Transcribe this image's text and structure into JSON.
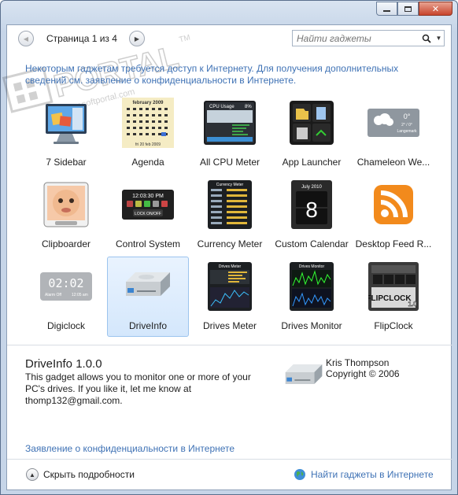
{
  "window": {
    "controls": [
      "minimize",
      "maximize",
      "close"
    ]
  },
  "toolbar": {
    "page_label": "Страница 1 из 4",
    "search_placeholder": "Найти гаджеты"
  },
  "privacy_note": "Некоторым гаджетам требуется доступ к Интернету. Для получения дополнительных сведений см. заявление о конфиденциальности в Интернете.",
  "watermark": {
    "text": "PORTAL",
    "sub": "www.softportal.com",
    "mark": "TM"
  },
  "gadgets": [
    {
      "label": "7 Sidebar"
    },
    {
      "label": "Agenda"
    },
    {
      "label": "All CPU Meter"
    },
    {
      "label": "App Launcher"
    },
    {
      "label": "Chameleon We..."
    },
    {
      "label": "Clipboarder"
    },
    {
      "label": "Control System"
    },
    {
      "label": "Currency Meter"
    },
    {
      "label": "Custom Calendar"
    },
    {
      "label": "Desktop Feed R..."
    },
    {
      "label": "Digiclock"
    },
    {
      "label": "DriveInfo",
      "selected": true
    },
    {
      "label": "Drives Meter"
    },
    {
      "label": "Drives Monitor"
    },
    {
      "label": "FlipClock"
    }
  ],
  "thumb_text": {
    "agenda_month": "february 2009",
    "agenda_footer": "fri 20 feb 2009",
    "cpu_title": "CPU Usage",
    "cpu_pct": "8%",
    "chameleon_temp": "0°",
    "chameleon_range": "2° / 0°",
    "chameleon_city": "Langemark",
    "control_time": "12:03:30 PM",
    "control_lock": "LOCK ON/OFF",
    "currency_title": "Currency Meter",
    "calendar_month": "July 2010",
    "calendar_day": "8",
    "digiclock_time": "02:02",
    "digiclock_sub1": "Alarm Off",
    "digiclock_sub2": "12:05 am",
    "drivesmeter_title": "Drives Meter",
    "drivesmonitor_title": "Drives Monitor",
    "flipclock_label": "FLIPCLOCK",
    "flipclock_version": "1.0"
  },
  "details": {
    "title": "DriveInfo 1.0.0",
    "description": "This gadget allows you to monitor one or more of your PC's drives. If you like it, let me know at thomp132@gmail.com.",
    "author": "Kris Thompson",
    "copyright": "Copyright © 2006"
  },
  "footer": {
    "privacy_link": "Заявление о конфиденциальности в Интернете",
    "hide_details": "Скрыть подробности",
    "online_link": "Найти гаджеты в Интернете"
  },
  "colors": {
    "link": "#3f72b5",
    "selected_bg": "#d4e7fc",
    "selected_border": "#9cc4ee"
  }
}
